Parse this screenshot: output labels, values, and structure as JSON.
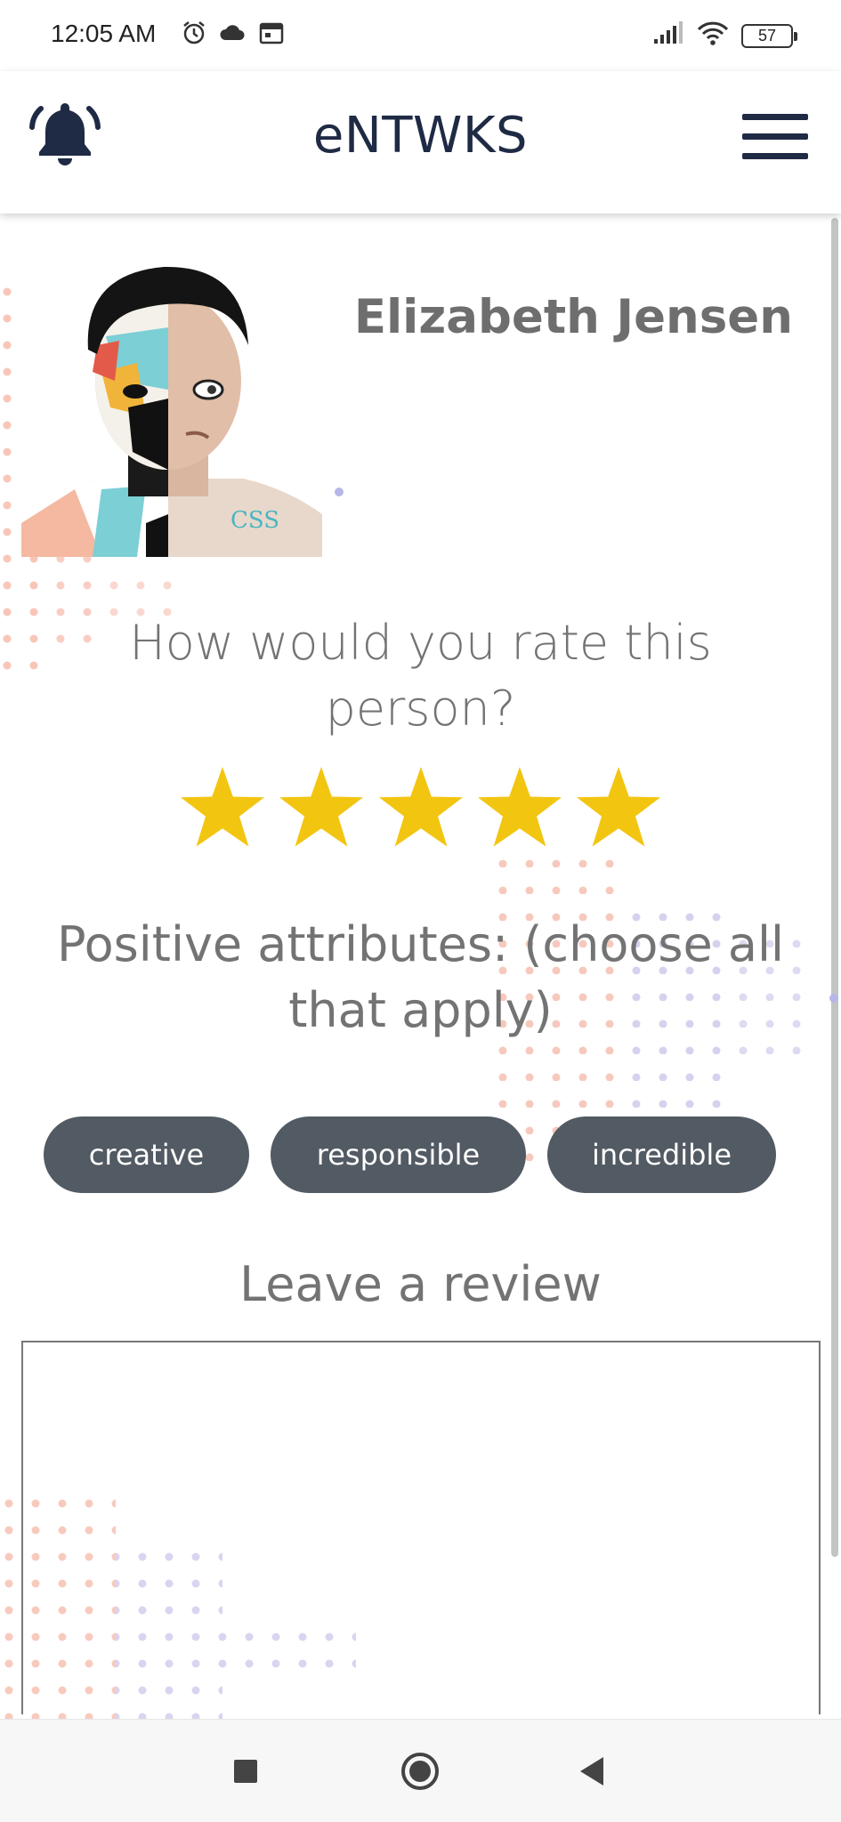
{
  "status_bar": {
    "time": "12:05 AM",
    "left_icons": [
      "alarm-icon",
      "cloud-icon",
      "calendar-icon"
    ],
    "right_icons": [
      "signal-icon",
      "wifi-icon"
    ],
    "battery": "57"
  },
  "header": {
    "title": "eNTWKS",
    "left_icon": "bell-icon",
    "right_icon": "hamburger-menu-icon"
  },
  "profile": {
    "name": "Elizabeth Jensen",
    "avatar_icon": "profile-photo"
  },
  "rating": {
    "question": "How would you rate this person?",
    "max": 5,
    "value": 5,
    "star_color": "#f2c511"
  },
  "attributes": {
    "heading": "Positive attributes: (choose all that apply)",
    "chips": [
      "creative",
      "responsible",
      "incredible"
    ],
    "chip_color": "#525a63"
  },
  "review": {
    "heading": "Leave a review",
    "value": "",
    "placeholder": ""
  },
  "nav": {
    "icons": [
      "recent-apps-icon",
      "home-icon",
      "back-icon"
    ]
  },
  "colors": {
    "brand_navy": "#1f2a44",
    "text_gray": "#737373"
  }
}
